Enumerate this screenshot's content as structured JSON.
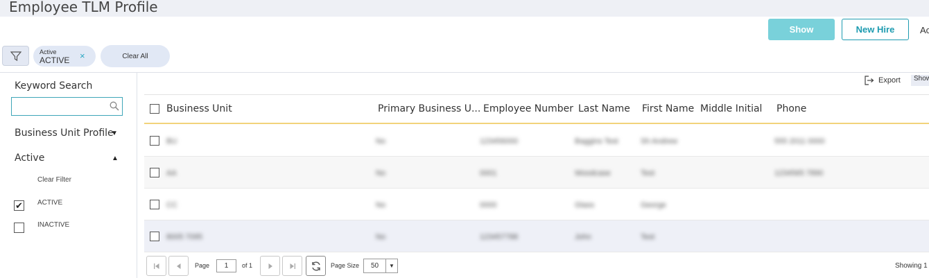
{
  "page": {
    "title": "Employee TLM Profile"
  },
  "header": {
    "show_label": "Show",
    "new_hire_label": "New Hire",
    "action_trunc": "Ac"
  },
  "filters": {
    "chip_key": "Active",
    "chip_value": "ACTIVE",
    "chip_remove": "×",
    "clear_all": "Clear All"
  },
  "sidebar": {
    "keyword_label": "Keyword Search",
    "keyword_value": "",
    "bu_profile_label": "Business Unit Profile",
    "active_label": "Active",
    "clear_filter": "Clear Filter",
    "options": [
      {
        "label": "ACTIVE",
        "checked": "✔"
      },
      {
        "label": "INACTIVE",
        "checked": ""
      }
    ]
  },
  "toolbar": {
    "export_label": "Export",
    "show_trunc": "Show"
  },
  "grid": {
    "columns": [
      "Business Unit",
      "Primary Business U...",
      "Employee Number",
      "Last Name",
      "First Name",
      "Middle Initial",
      "Phone"
    ],
    "rows": [
      [
        "BU",
        "No",
        "123456000",
        "Baggins Test",
        "Sh Andrew",
        "",
        "555 2011 0000"
      ],
      [
        "AA",
        "No",
        "0001",
        "Woodcase",
        "Test",
        "",
        "1234565 7890"
      ],
      [
        "CC",
        "No",
        "0000",
        "Glass",
        "George",
        "",
        ""
      ],
      [
        "8005 7095",
        "No",
        "123457788",
        "John",
        "Test",
        "",
        ""
      ]
    ]
  },
  "pager": {
    "page_label": "Page",
    "page_value": "1",
    "of_label": "of 1",
    "page_size_label": "Page Size",
    "page_size_value": "50",
    "showing": "Showing 1"
  },
  "colors": {
    "accent": "#1d9bb0",
    "show_button": "#79d1da",
    "header_rule": "#f2d37a"
  }
}
